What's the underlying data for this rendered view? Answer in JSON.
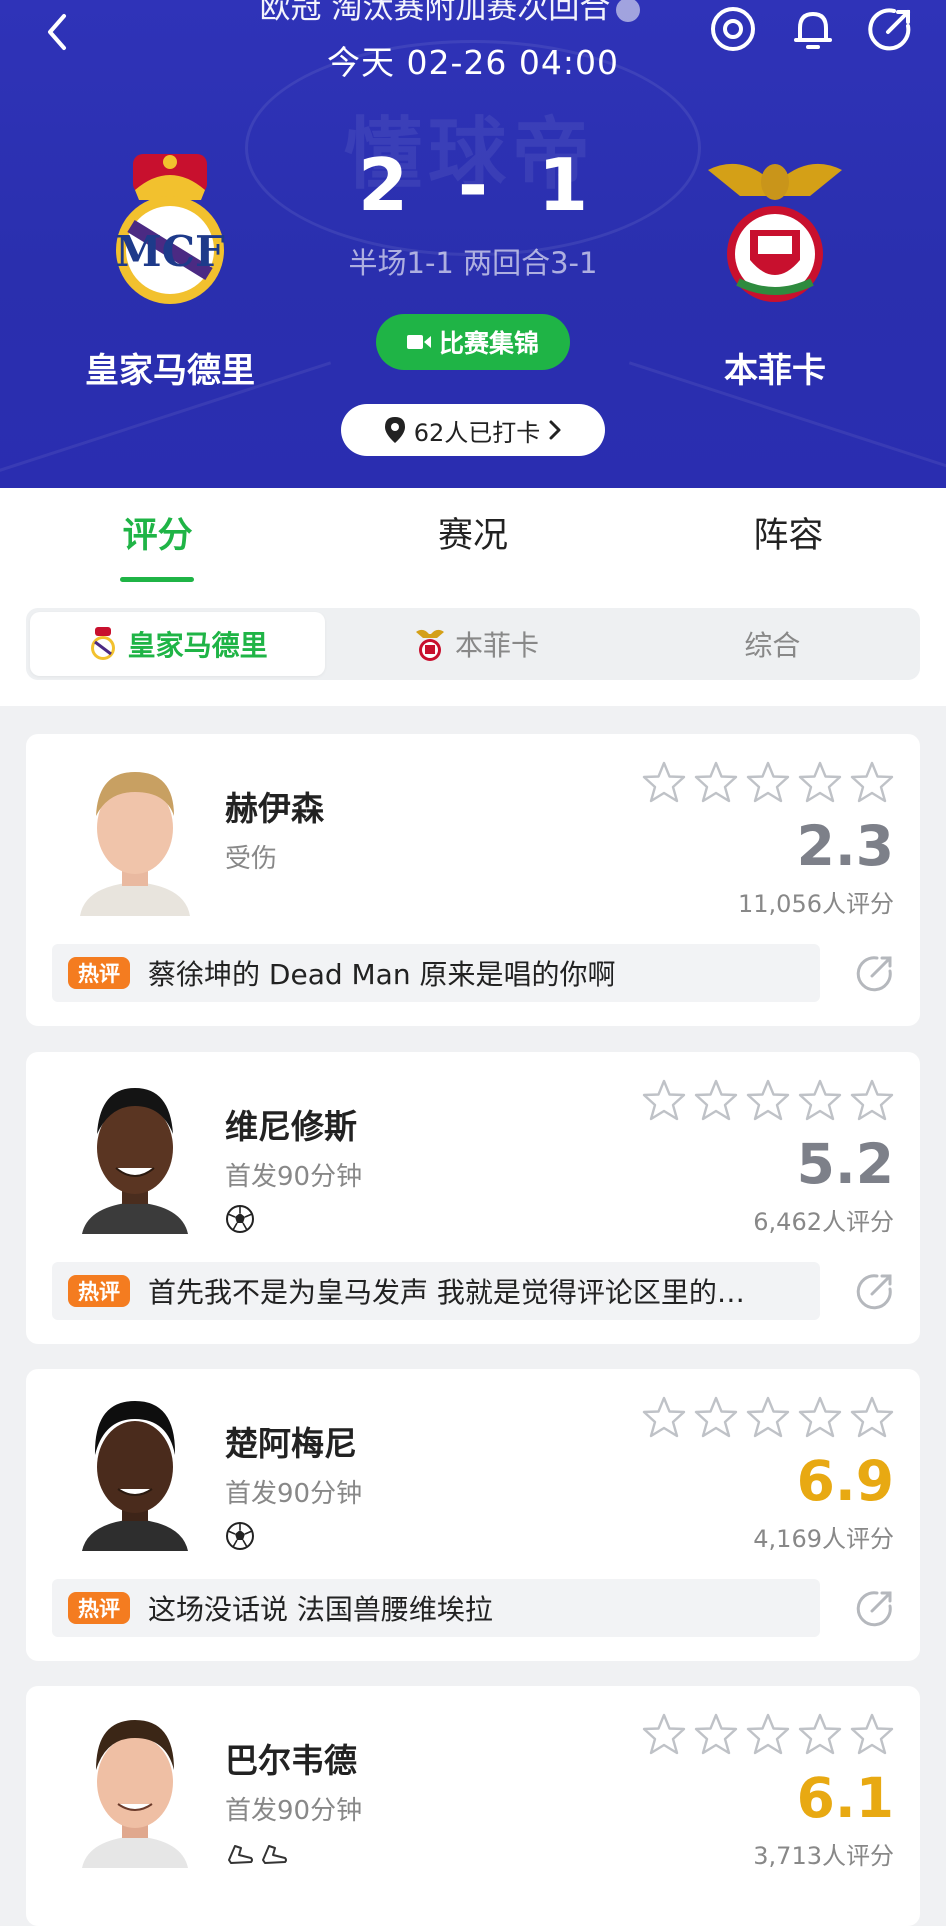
{
  "header": {
    "competition": "欧冠 淘汰赛附加赛次回合",
    "match_time": "今天 02-26 04:00",
    "home_team": "皇家马德里",
    "away_team": "本菲卡",
    "home_score": "2",
    "away_score": "1",
    "separator": "-",
    "score_detail": "半场1-1 两回合3-1",
    "highlights_label": "比赛集锦",
    "checkin_label": "62人已打卡",
    "icons": [
      "back-icon",
      "target-icon",
      "bell-icon",
      "share-icon",
      "info-icon",
      "location-icon",
      "chevron-right-icon",
      "video-icon"
    ]
  },
  "tabs": [
    "评分",
    "赛况",
    "阵容"
  ],
  "active_tab": "评分",
  "team_tabs": [
    "皇家马德里",
    "本菲卡",
    "综合"
  ],
  "active_team_tab": "皇家马德里",
  "players": [
    {
      "name": "赫伊森",
      "status": "受伤",
      "event_icons": [],
      "rating": "2.3",
      "rating_color": "#7d8089",
      "rating_count": "11,056人评分",
      "comment_badge": "热评",
      "comment": "蔡徐坤的 Dead Man 原来是唱的你啊"
    },
    {
      "name": "维尼修斯",
      "status": "首发90分钟",
      "event_icons": [
        "goal-icon"
      ],
      "rating": "5.2",
      "rating_color": "#7d8089",
      "rating_count": "6,462人评分",
      "comment_badge": "热评",
      "comment": "首先我不是为皇马发声 我就是觉得评论区里的…"
    },
    {
      "name": "楚阿梅尼",
      "status": "首发90分钟",
      "event_icons": [
        "goal-icon"
      ],
      "rating": "6.9",
      "rating_color": "#e8a912",
      "rating_count": "4,169人评分",
      "comment_badge": "热评",
      "comment": "这场没话说 法国兽腰维埃拉"
    },
    {
      "name": "巴尔韦德",
      "status": "首发90分钟",
      "event_icons": [
        "assist-boot-icon",
        "assist-boot-icon"
      ],
      "rating": "6.1",
      "rating_color": "#e8a912",
      "rating_count": "3,713人评分"
    }
  ]
}
